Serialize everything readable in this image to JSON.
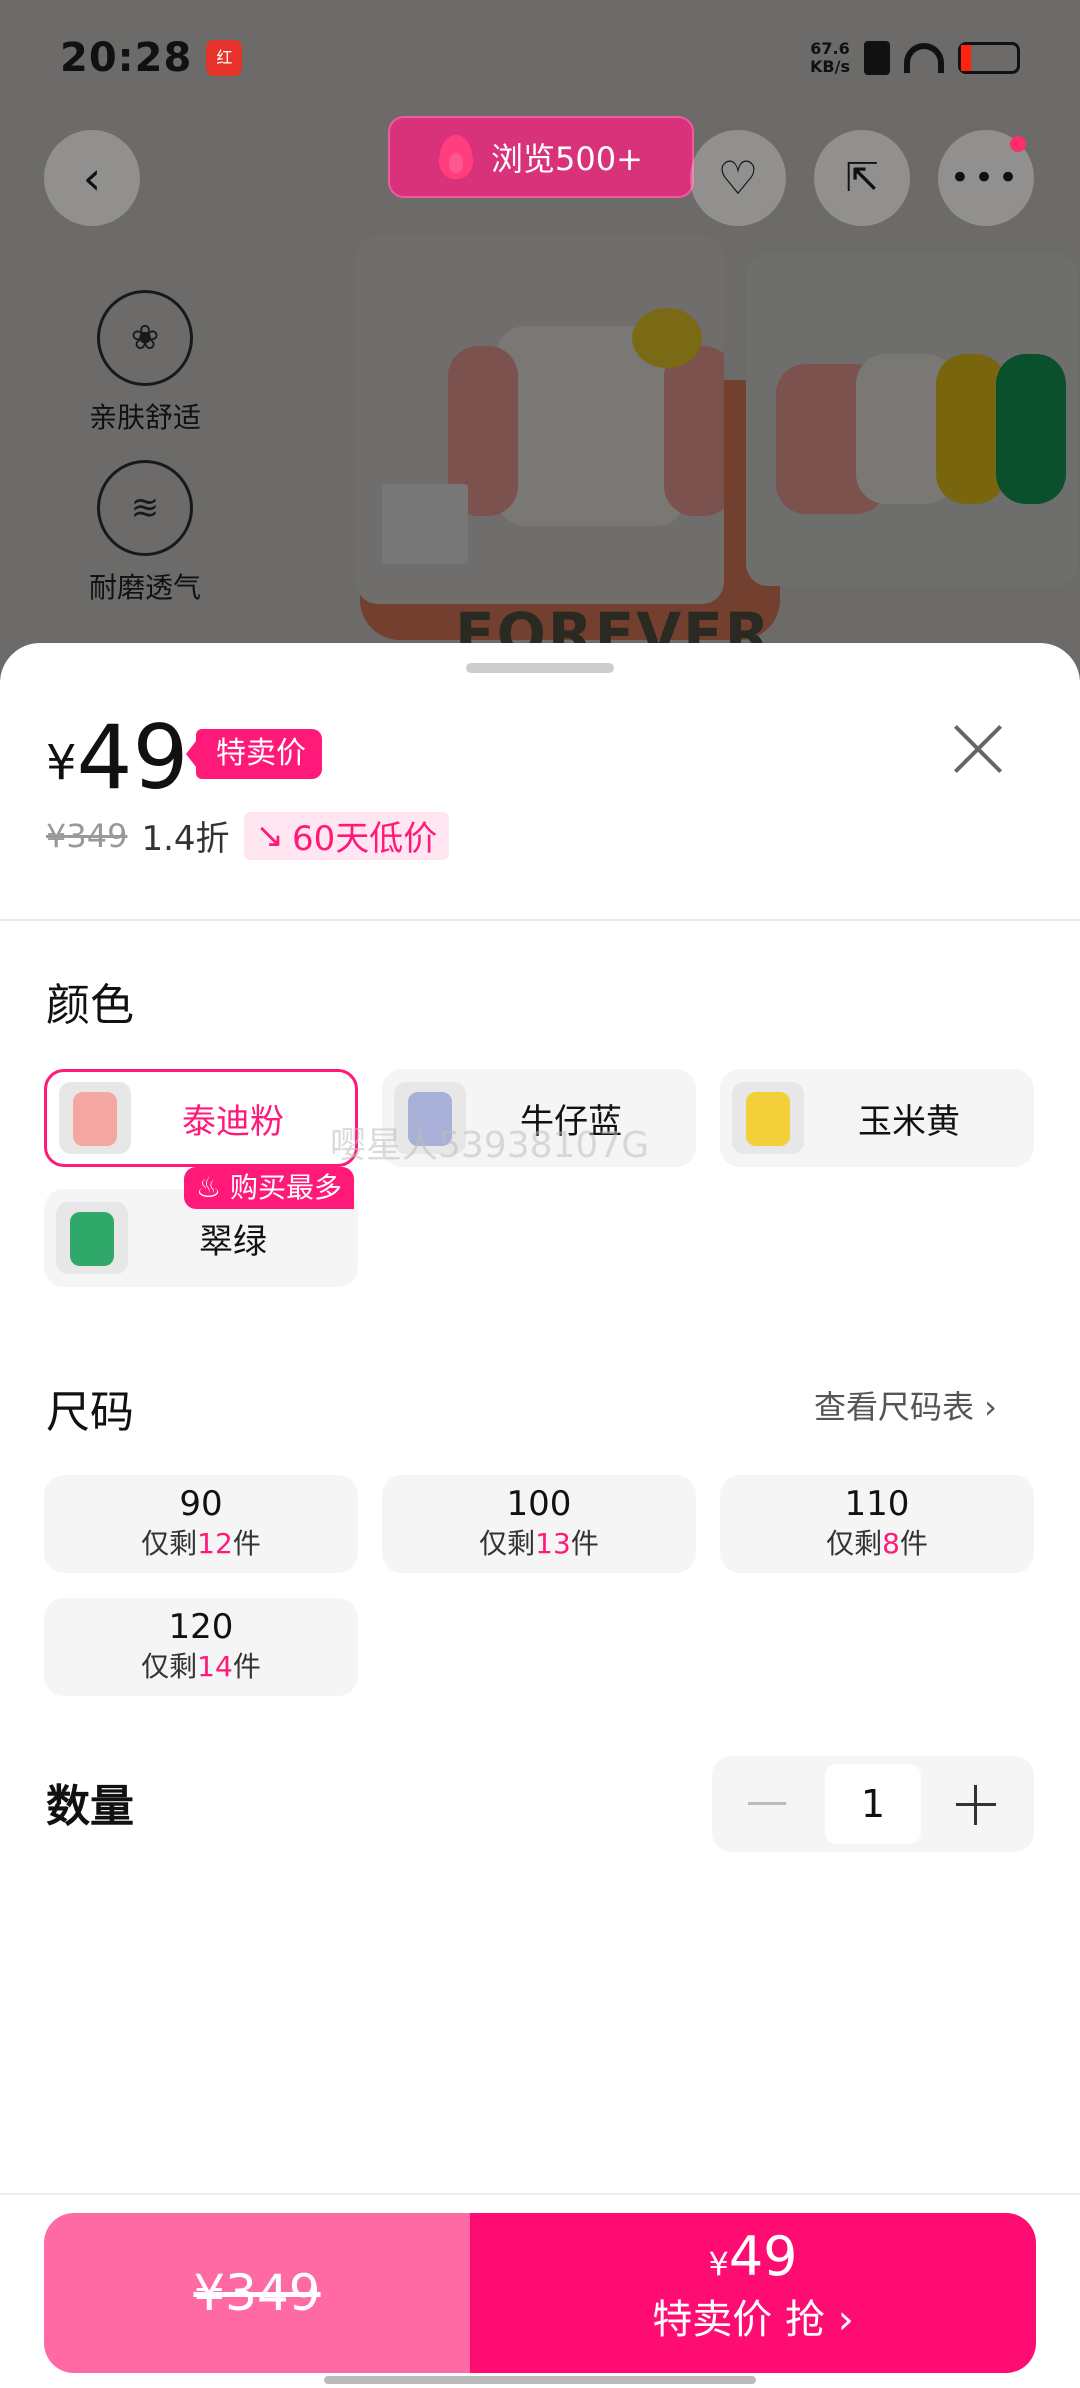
{
  "status_bar": {
    "time": "20:28",
    "app_icon_text": "红",
    "net_speed": "67.6",
    "net_unit": "KB/s"
  },
  "header": {
    "browse_label": "浏览500+"
  },
  "background": {
    "features": [
      "亲肤舒适",
      "耐磨透气"
    ],
    "shirt_text": "FOREVER"
  },
  "sheet": {
    "currency": "¥",
    "price": "49",
    "sale_tag": "特卖价",
    "original_price": "¥349",
    "discount": "1.4折",
    "low_price_badge": "60天低价",
    "color_title": "颜色",
    "colors": [
      {
        "label": "泰迪粉",
        "selected": true,
        "swatch": "#f4a6a0"
      },
      {
        "label": "牛仔蓝",
        "selected": false,
        "swatch": "#a9b0d8"
      },
      {
        "label": "玉米黄",
        "selected": false,
        "swatch": "#f3cf3a"
      },
      {
        "label": "翠绿",
        "selected": false,
        "swatch": "#2fa869"
      }
    ],
    "best_seller_badge": "购买最多",
    "watermark": "嘤星人53938107G",
    "size_title": "尺码",
    "size_chart_link": "查看尺码表 ›",
    "sizes": [
      {
        "size": "90",
        "prefix": "仅剩",
        "count": "12",
        "unit": "件"
      },
      {
        "size": "100",
        "prefix": "仅剩",
        "count": "13",
        "unit": "件"
      },
      {
        "size": "110",
        "prefix": "仅剩",
        "count": "8",
        "unit": "件"
      },
      {
        "size": "120",
        "prefix": "仅剩",
        "count": "14",
        "unit": "件"
      }
    ],
    "quantity_title": "数量",
    "quantity": "1"
  },
  "bottom_bar": {
    "original_price": "¥349",
    "currency": "¥",
    "sale_price": "49",
    "buy_label": "特卖价 抢 ›"
  },
  "colors": {
    "accent": "#ff1a7a",
    "buy_left": "#ff6aa5",
    "buy_right": "#ff0c73"
  }
}
